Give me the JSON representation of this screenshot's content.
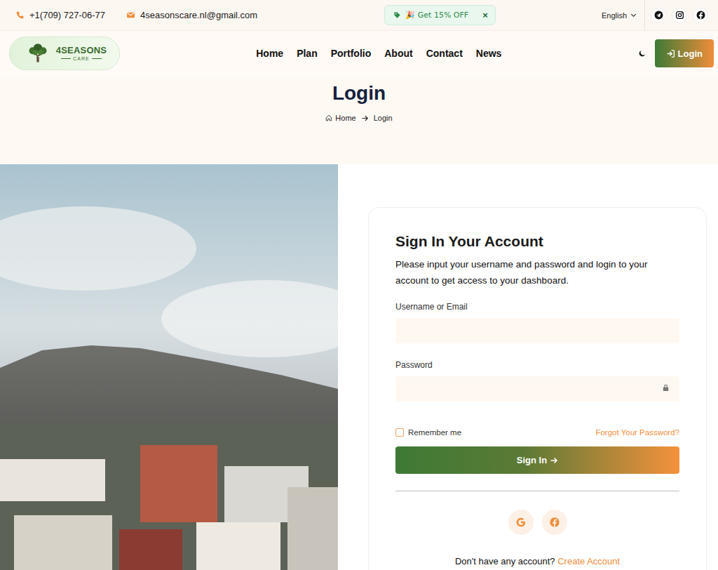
{
  "topbar": {
    "phone": "+1(709) 727-06-77",
    "email": "4seasonscare.nl@gmail.com",
    "promo": {
      "text": "🎉 Get 15% OFF",
      "close": "×"
    },
    "language": "English"
  },
  "logo": {
    "title": "4SEASONS",
    "subtitle": "CARE"
  },
  "nav": {
    "items": [
      "Home",
      "Plan",
      "Portfolio",
      "About",
      "Contact",
      "News"
    ],
    "login_button": "Login"
  },
  "header": {
    "title": "Login",
    "breadcrumb": [
      "Home",
      "Login"
    ]
  },
  "form": {
    "title": "Sign In Your Account",
    "description": "Please input your username and password and login to your account to get access to your dashboard.",
    "fields": [
      {
        "label": "Username or Email",
        "value": ""
      },
      {
        "label": "Password",
        "value": ""
      }
    ],
    "remember": {
      "label": "Remember me",
      "checked": false
    },
    "forgot": "Forgot Your Password?",
    "submit": "Sign In",
    "signup": {
      "prompt": "Don't have any account?",
      "link": "Create Account"
    }
  }
}
